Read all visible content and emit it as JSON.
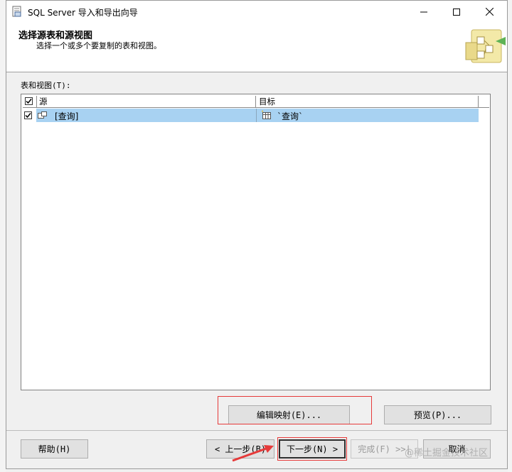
{
  "window": {
    "title": "SQL Server 导入和导出向导"
  },
  "header": {
    "title": "选择源表和源视图",
    "subtitle": "选择一个或多个要复制的表和视图。"
  },
  "grid": {
    "label": "表和视图(T):",
    "columns": [
      "源",
      "目标"
    ],
    "rows": [
      {
        "checked": true,
        "source": "[查询]",
        "destination": "`查询`"
      }
    ],
    "selection_color": "#a8d2f2"
  },
  "buttons": {
    "edit_mappings": "编辑映射(E)...",
    "preview": "预览(P)...",
    "help": "帮助(H)",
    "back": "< 上一步(B)",
    "next": "下一步(N) >",
    "finish": "完成(F) >>|",
    "cancel": "取消"
  },
  "watermark": "@稀土掘金技术社区",
  "colors": {
    "annotation": "#e63a3a"
  }
}
